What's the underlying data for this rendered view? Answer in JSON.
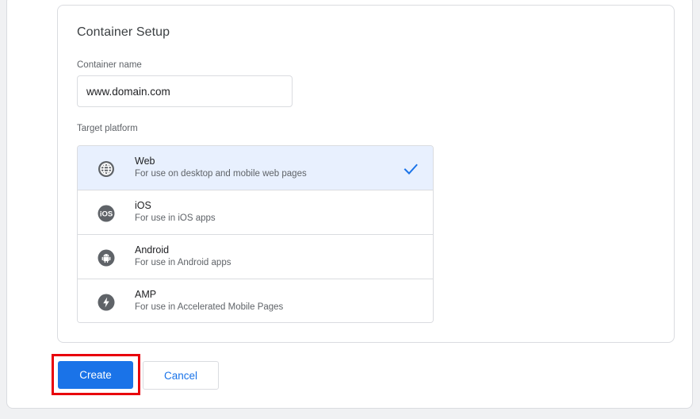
{
  "container_setup": {
    "title": "Container Setup",
    "name_label": "Container name",
    "name_value": "www.domain.com",
    "platform_label": "Target platform",
    "platforms": [
      {
        "icon": "globe-icon",
        "title": "Web",
        "description": "For use on desktop and mobile web pages",
        "selected": true
      },
      {
        "icon": "ios-icon",
        "title": "iOS",
        "description": "For use in iOS apps",
        "selected": false
      },
      {
        "icon": "android-icon",
        "title": "Android",
        "description": "For use in Android apps",
        "selected": false
      },
      {
        "icon": "amp-icon",
        "title": "AMP",
        "description": "For use in Accelerated Mobile Pages",
        "selected": false
      }
    ]
  },
  "actions": {
    "create_label": "Create",
    "cancel_label": "Cancel"
  },
  "colors": {
    "accent": "#1a73e8",
    "selected_bg": "#e8f0fe",
    "highlight": "#e8000b"
  }
}
